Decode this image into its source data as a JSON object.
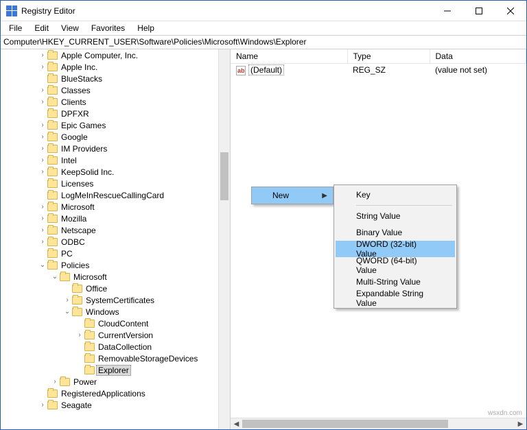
{
  "window": {
    "title": "Registry Editor"
  },
  "menu": {
    "file": "File",
    "edit": "Edit",
    "view": "View",
    "favorites": "Favorites",
    "help": "Help"
  },
  "path": "Computer\\HKEY_CURRENT_USER\\Software\\Policies\\Microsoft\\Windows\\Explorer",
  "tree": {
    "items": [
      {
        "label": "Apple Computer, Inc.",
        "indent": 1,
        "twisty": ">"
      },
      {
        "label": "Apple Inc.",
        "indent": 1,
        "twisty": ">"
      },
      {
        "label": "BlueStacks",
        "indent": 1,
        "twisty": ""
      },
      {
        "label": "Classes",
        "indent": 1,
        "twisty": ">"
      },
      {
        "label": "Clients",
        "indent": 1,
        "twisty": ">"
      },
      {
        "label": "DPFXR",
        "indent": 1,
        "twisty": ""
      },
      {
        "label": "Epic Games",
        "indent": 1,
        "twisty": ">"
      },
      {
        "label": "Google",
        "indent": 1,
        "twisty": ">"
      },
      {
        "label": "IM Providers",
        "indent": 1,
        "twisty": ">"
      },
      {
        "label": "Intel",
        "indent": 1,
        "twisty": ">"
      },
      {
        "label": "KeepSolid Inc.",
        "indent": 1,
        "twisty": ">"
      },
      {
        "label": "Licenses",
        "indent": 1,
        "twisty": ""
      },
      {
        "label": "LogMeInRescueCallingCard",
        "indent": 1,
        "twisty": ""
      },
      {
        "label": "Microsoft",
        "indent": 1,
        "twisty": ">"
      },
      {
        "label": "Mozilla",
        "indent": 1,
        "twisty": ">"
      },
      {
        "label": "Netscape",
        "indent": 1,
        "twisty": ">"
      },
      {
        "label": "ODBC",
        "indent": 1,
        "twisty": ">"
      },
      {
        "label": "PC",
        "indent": 1,
        "twisty": ""
      },
      {
        "label": "Policies",
        "indent": 1,
        "twisty": "v"
      },
      {
        "label": "Microsoft",
        "indent": 2,
        "twisty": "v"
      },
      {
        "label": "Office",
        "indent": 3,
        "twisty": ""
      },
      {
        "label": "SystemCertificates",
        "indent": 3,
        "twisty": ">"
      },
      {
        "label": "Windows",
        "indent": 3,
        "twisty": "v"
      },
      {
        "label": "CloudContent",
        "indent": 4,
        "twisty": ""
      },
      {
        "label": "CurrentVersion",
        "indent": 4,
        "twisty": ">"
      },
      {
        "label": "DataCollection",
        "indent": 4,
        "twisty": ""
      },
      {
        "label": "RemovableStorageDevices",
        "indent": 4,
        "twisty": ""
      },
      {
        "label": "Explorer",
        "indent": 4,
        "twisty": "",
        "selected": true
      },
      {
        "label": "Power",
        "indent": 2,
        "twisty": ">"
      },
      {
        "label": "RegisteredApplications",
        "indent": 1,
        "twisty": ""
      },
      {
        "label": "Seagate",
        "indent": 1,
        "twisty": ">"
      }
    ]
  },
  "list": {
    "columns": {
      "name": "Name",
      "type": "Type",
      "data": "Data"
    },
    "rows": [
      {
        "name": "(Default)",
        "type": "REG_SZ",
        "data": "(value not set)"
      }
    ]
  },
  "context": {
    "new": "New",
    "sub": {
      "key": "Key",
      "string": "String Value",
      "binary": "Binary Value",
      "dword": "DWORD (32-bit) Value",
      "qword": "QWORD (64-bit) Value",
      "multi": "Multi-String Value",
      "expand": "Expandable String Value"
    }
  },
  "watermark": "wsxdn.com"
}
